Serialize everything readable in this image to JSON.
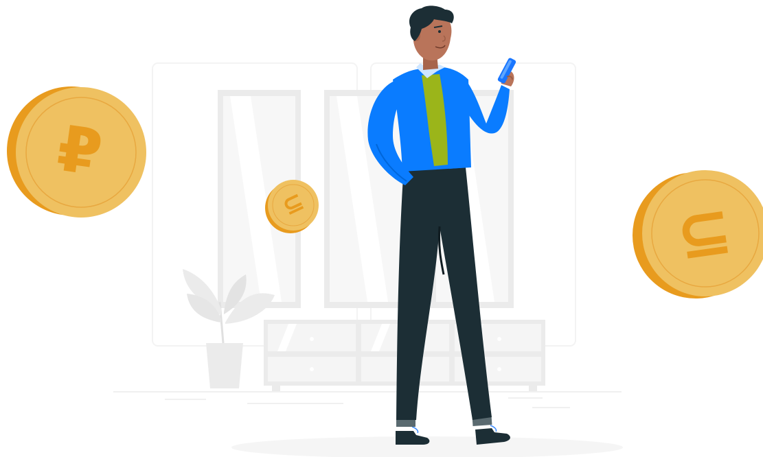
{
  "scene": {
    "description_kind": "illustration",
    "colors": {
      "background": "#ffffff",
      "coin_face": "#EFC161",
      "coin_edge": "#E89B1E",
      "coin_mark": "#E89B1E",
      "room_gray": "#EBEBEB",
      "room_light": "#F5F5F5",
      "jacket": "#0A7CFF",
      "vest": "#9BB51A",
      "pants": "#1C2E35",
      "skin": "#B9745A",
      "hair": "#1C2E35",
      "phone": "#1976FF",
      "shoe": "#1C2E35",
      "sock": "#5A6A70"
    },
    "coins": [
      {
        "id": "ruble",
        "symbol": "₽"
      },
      {
        "id": "som",
        "symbol": "⊆"
      },
      {
        "id": "small",
        "symbol": "⊆"
      }
    ],
    "icons": [
      "ruble-coin-icon",
      "som-coin-icon",
      "small-coin-icon",
      "houseplant-icon",
      "smartphone-icon"
    ]
  }
}
